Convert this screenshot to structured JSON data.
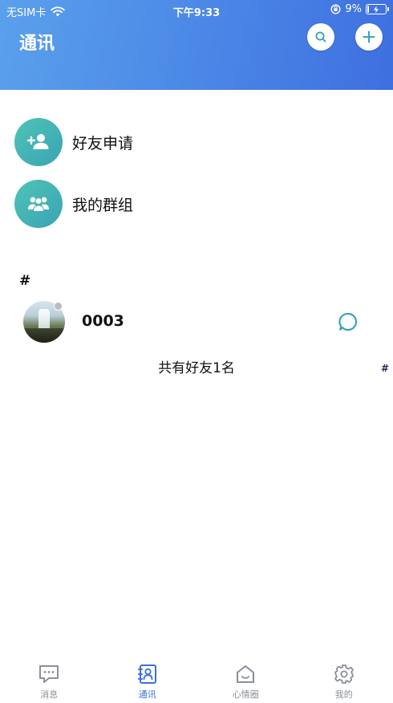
{
  "status_bar": {
    "carrier": "无SIM卡",
    "time": "下午9:33",
    "battery_text": "9%",
    "battery_level": 0.09
  },
  "header": {
    "title": "通讯"
  },
  "menu": [
    {
      "label": "好友申请",
      "icon": "add-user-icon"
    },
    {
      "label": "我的群组",
      "icon": "group-icon"
    }
  ],
  "contacts": {
    "section_letter": "#",
    "items": [
      {
        "name": "0003",
        "online": false
      }
    ],
    "summary": "共有好友1名",
    "index_letter": "#"
  },
  "tabs": [
    {
      "label": "消息",
      "icon": "message-icon",
      "active": false
    },
    {
      "label": "通讯",
      "icon": "contacts-icon",
      "active": true
    },
    {
      "label": "心情圈",
      "icon": "home-icon",
      "active": false
    },
    {
      "label": "我的",
      "icon": "gear-icon",
      "active": false
    }
  ],
  "colors": {
    "header_start": "#5aa0ec",
    "header_end": "#3f6fe0",
    "teal": "#3aa4b4",
    "active_tab": "#3c6fe0",
    "inactive_tab": "#8a8f99"
  }
}
